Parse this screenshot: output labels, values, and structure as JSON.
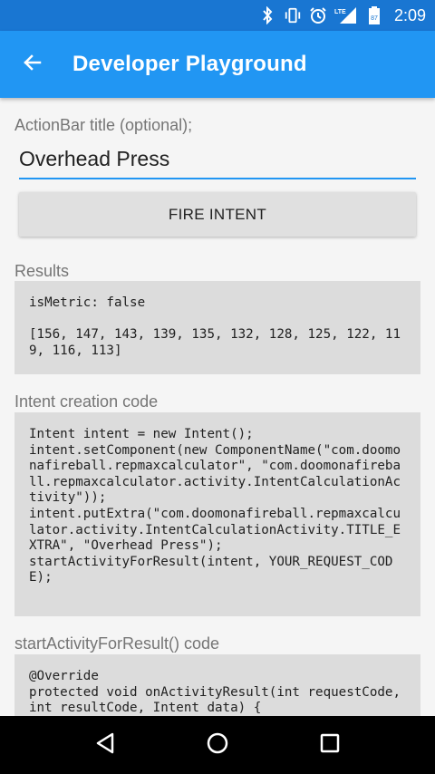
{
  "status_bar": {
    "time": "2:09",
    "icons": [
      "bluetooth-icon",
      "vibrate-icon",
      "alarm-icon",
      "lte-signal-icon",
      "battery-icon"
    ],
    "lte_label": "LTE",
    "battery_level": "87"
  },
  "app_bar": {
    "title": "Developer Playground",
    "back_icon": "arrow-back-icon",
    "color": "#2196F3",
    "status_color": "#1976D2"
  },
  "form": {
    "actionbar_label": "ActionBar title (optional);",
    "title_value": "Overhead Press",
    "fire_button_label": "FIRE INTENT"
  },
  "results": {
    "label": "Results",
    "text": "isMetric: false\n\n[156, 147, 143, 139, 135, 132, 128, 125, 122, 119, 116, 113]"
  },
  "intent_code": {
    "label": "Intent creation code",
    "text": "Intent intent = new Intent();\nintent.setComponent(new ComponentName(\"com.doomonafireball.repmaxcalculator\", \"com.doomonafireball.repmaxcalculator.activity.IntentCalculationActivity\"));\nintent.putExtra(\"com.doomonafireball.repmaxcalculator.activity.IntentCalculationActivity.TITLE_EXTRA\", \"Overhead Press\");\nstartActivityForResult(intent, YOUR_REQUEST_CODE);"
  },
  "result_code": {
    "label": "startActivityForResult() code",
    "text": "@Override\nprotected void onActivityResult(int requestCode, int resultCode, Intent data) {"
  },
  "nav_bar": {
    "buttons": [
      "back-triangle-icon",
      "home-circle-icon",
      "recents-square-icon"
    ]
  }
}
